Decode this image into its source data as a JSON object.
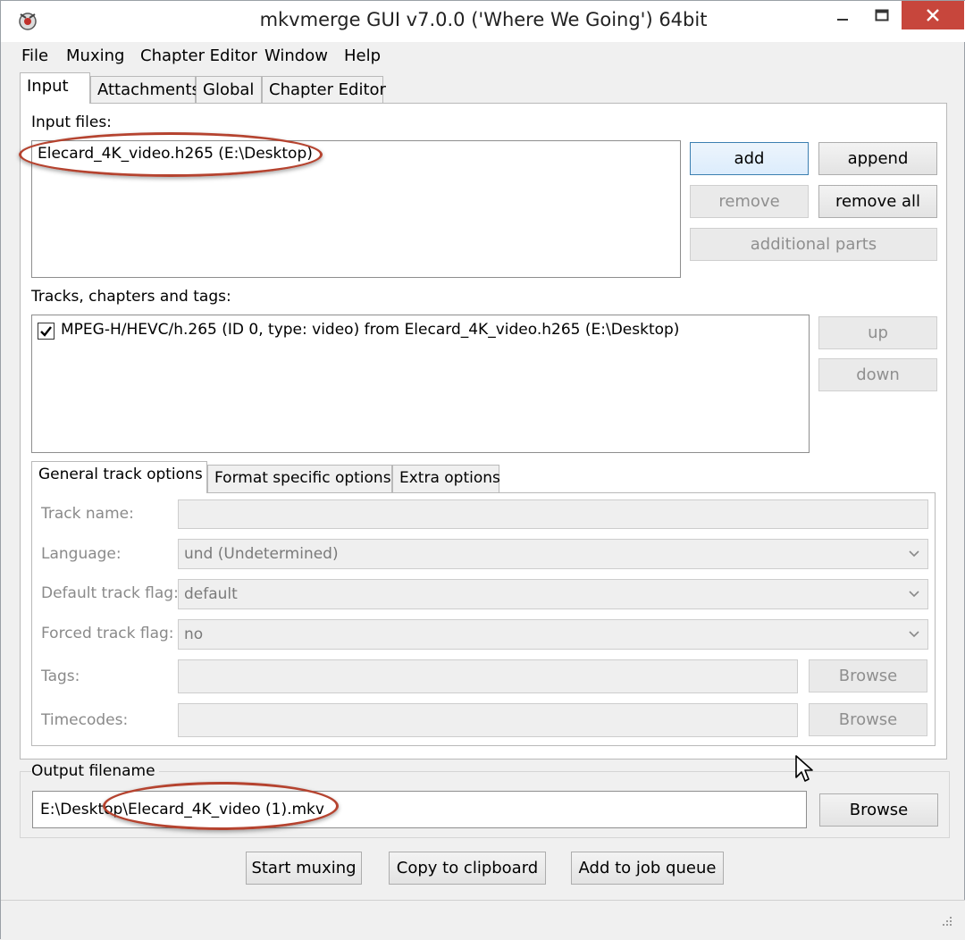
{
  "window": {
    "title": "mkvmerge GUI v7.0.0 ('Where We Going') 64bit"
  },
  "menu": [
    "File",
    "Muxing",
    "Chapter Editor",
    "Window",
    "Help"
  ],
  "tabs": [
    "Input",
    "Attachments",
    "Global",
    "Chapter Editor"
  ],
  "input": {
    "files_label": "Input files:",
    "files": [
      "Elecard_4K_video.h265 (E:\\Desktop)"
    ],
    "buttons": {
      "add": "add",
      "append": "append",
      "remove": "remove",
      "remove_all": "remove all",
      "additional_parts": "additional parts"
    },
    "tracks_label": "Tracks, chapters and tags:",
    "tracks": [
      {
        "checked": true,
        "label": "MPEG-H/HEVC/h.265 (ID 0, type: video) from Elecard_4K_video.h265 (E:\\Desktop)"
      }
    ],
    "track_buttons": {
      "up": "up",
      "down": "down"
    }
  },
  "track_tabs": [
    "General track options",
    "Format specific options",
    "Extra options"
  ],
  "track_options": {
    "track_name_label": "Track name:",
    "track_name_value": "",
    "language_label": "Language:",
    "language_value": "und (Undetermined)",
    "default_flag_label": "Default track flag:",
    "default_flag_value": "default",
    "forced_flag_label": "Forced track flag:",
    "forced_flag_value": "no",
    "tags_label": "Tags:",
    "tags_value": "",
    "timecodes_label": "Timecodes:",
    "timecodes_value": "",
    "browse_label": "Browse"
  },
  "output": {
    "label": "Output filename",
    "value": "E:\\Desktop\\Elecard_4K_video (1).mkv",
    "browse_label": "Browse"
  },
  "actions": {
    "start_muxing": "Start muxing",
    "copy_clipboard": "Copy to clipboard",
    "add_job_queue": "Add to job queue"
  },
  "colors": {
    "highlight_circle": "#b5432f",
    "close_button": "#c7463c"
  }
}
